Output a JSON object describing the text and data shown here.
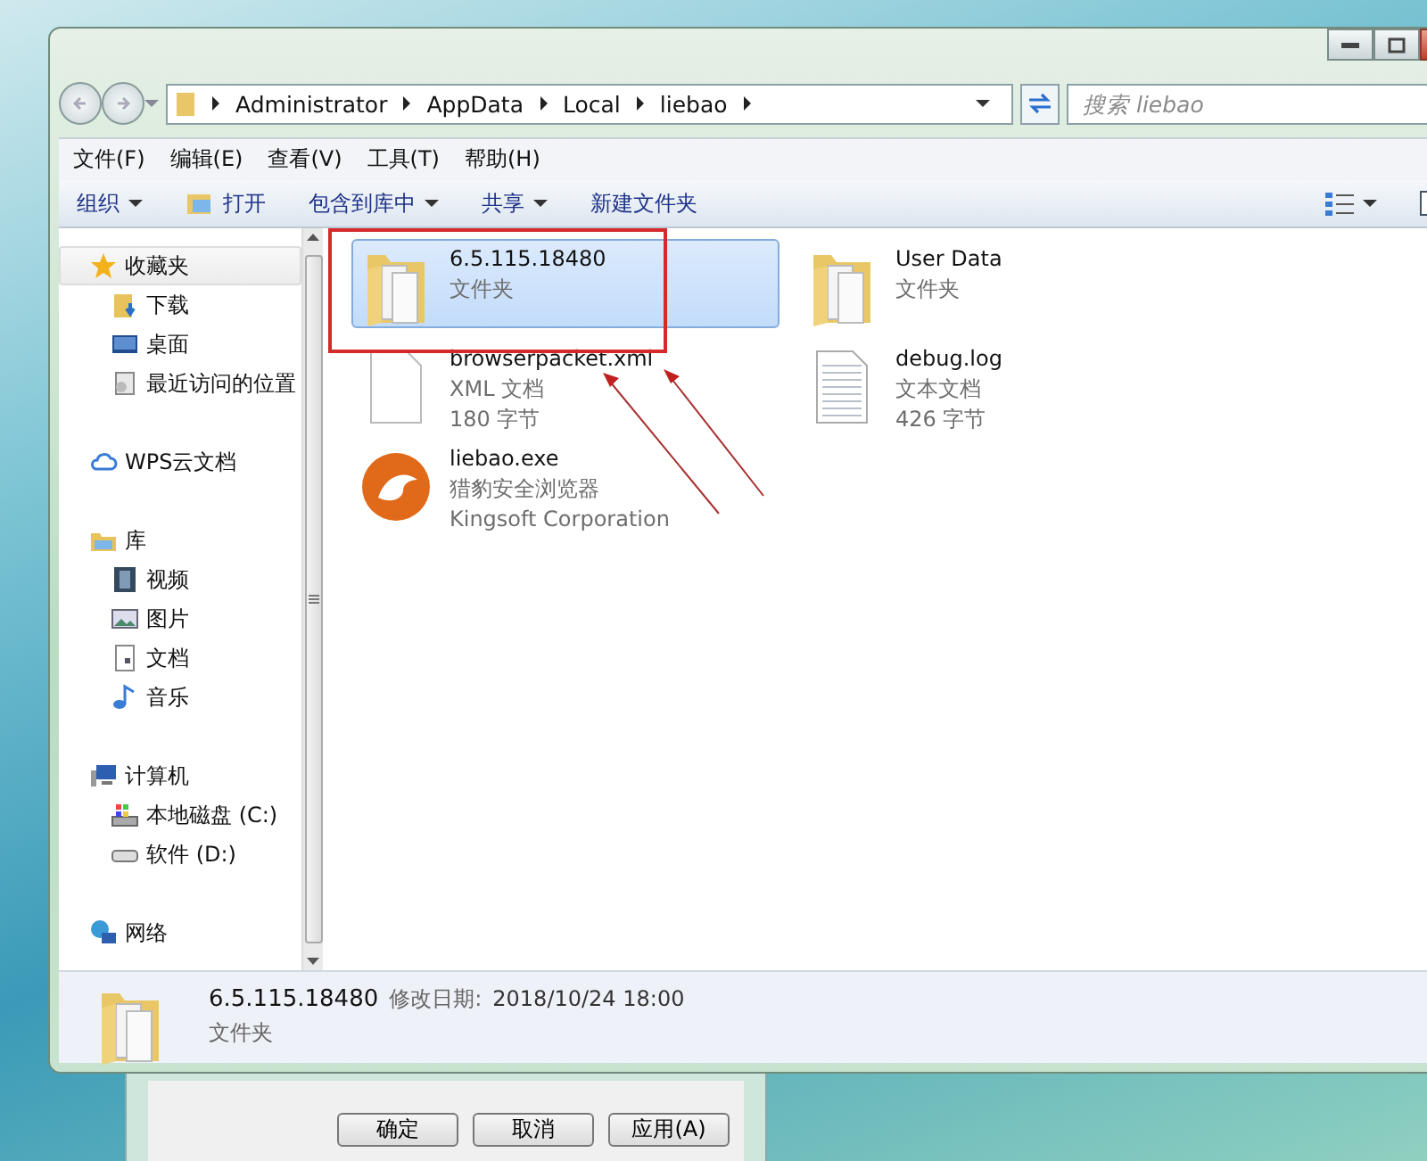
{
  "address": {
    "path": [
      "Administrator",
      "AppData",
      "Local",
      "liebao"
    ]
  },
  "search": {
    "placeholder": "搜索 liebao"
  },
  "menu": [
    "文件(F)",
    "编辑(E)",
    "查看(V)",
    "工具(T)",
    "帮助(H)"
  ],
  "toolbar": [
    {
      "label": "组织",
      "kind": "dropdown"
    },
    {
      "label": "打开",
      "kind": "icon"
    },
    {
      "label": "包含到库中",
      "kind": "dropdown"
    },
    {
      "label": "共享",
      "kind": "dropdown"
    },
    {
      "label": "新建文件夹",
      "kind": "plain"
    }
  ],
  "sidebar": [
    {
      "label": "收藏夹",
      "kind": "star",
      "selected": true,
      "children": [
        {
          "label": "下载",
          "kind": "download"
        },
        {
          "label": "桌面",
          "kind": "desktop"
        },
        {
          "label": "最近访问的位置",
          "kind": "recent"
        }
      ]
    },
    {
      "label": "WPS云文档",
      "kind": "cloud",
      "selected": false
    },
    {
      "label": "库",
      "kind": "library",
      "selected": false,
      "children": [
        {
          "label": "视频",
          "kind": "video"
        },
        {
          "label": "图片",
          "kind": "picture"
        },
        {
          "label": "文档",
          "kind": "document"
        },
        {
          "label": "音乐",
          "kind": "music"
        }
      ]
    },
    {
      "label": "计算机",
      "kind": "computer",
      "selected": false,
      "children": [
        {
          "label": "本地磁盘 (C:)",
          "kind": "disk"
        },
        {
          "label": "软件 (D:)",
          "kind": "drive"
        }
      ]
    },
    {
      "label": "网络",
      "kind": "network",
      "selected": false
    }
  ],
  "files": [
    {
      "name": "6.5.115.18480",
      "lines": [
        "文件夹"
      ],
      "kind": "folder",
      "selected": true
    },
    {
      "name": "User Data",
      "lines": [
        "文件夹"
      ],
      "kind": "folder",
      "selected": false
    },
    {
      "name": "browserpacket.xml",
      "lines": [
        "XML 文档",
        "180 字节"
      ],
      "kind": "xml",
      "selected": false
    },
    {
      "name": "debug.log",
      "lines": [
        "文本文档",
        "426 字节"
      ],
      "kind": "text",
      "selected": false
    },
    {
      "name": "liebao.exe",
      "lines": [
        "猎豹安全浏览器",
        "Kingsoft Corporation"
      ],
      "kind": "app",
      "selected": false
    }
  ],
  "details": {
    "name": "6.5.115.18480",
    "label": "修改日期:",
    "value": "2018/10/24 18:00",
    "type": "文件夹"
  },
  "dialog_buttons": [
    "确定",
    "取消",
    "应用(A)"
  ]
}
